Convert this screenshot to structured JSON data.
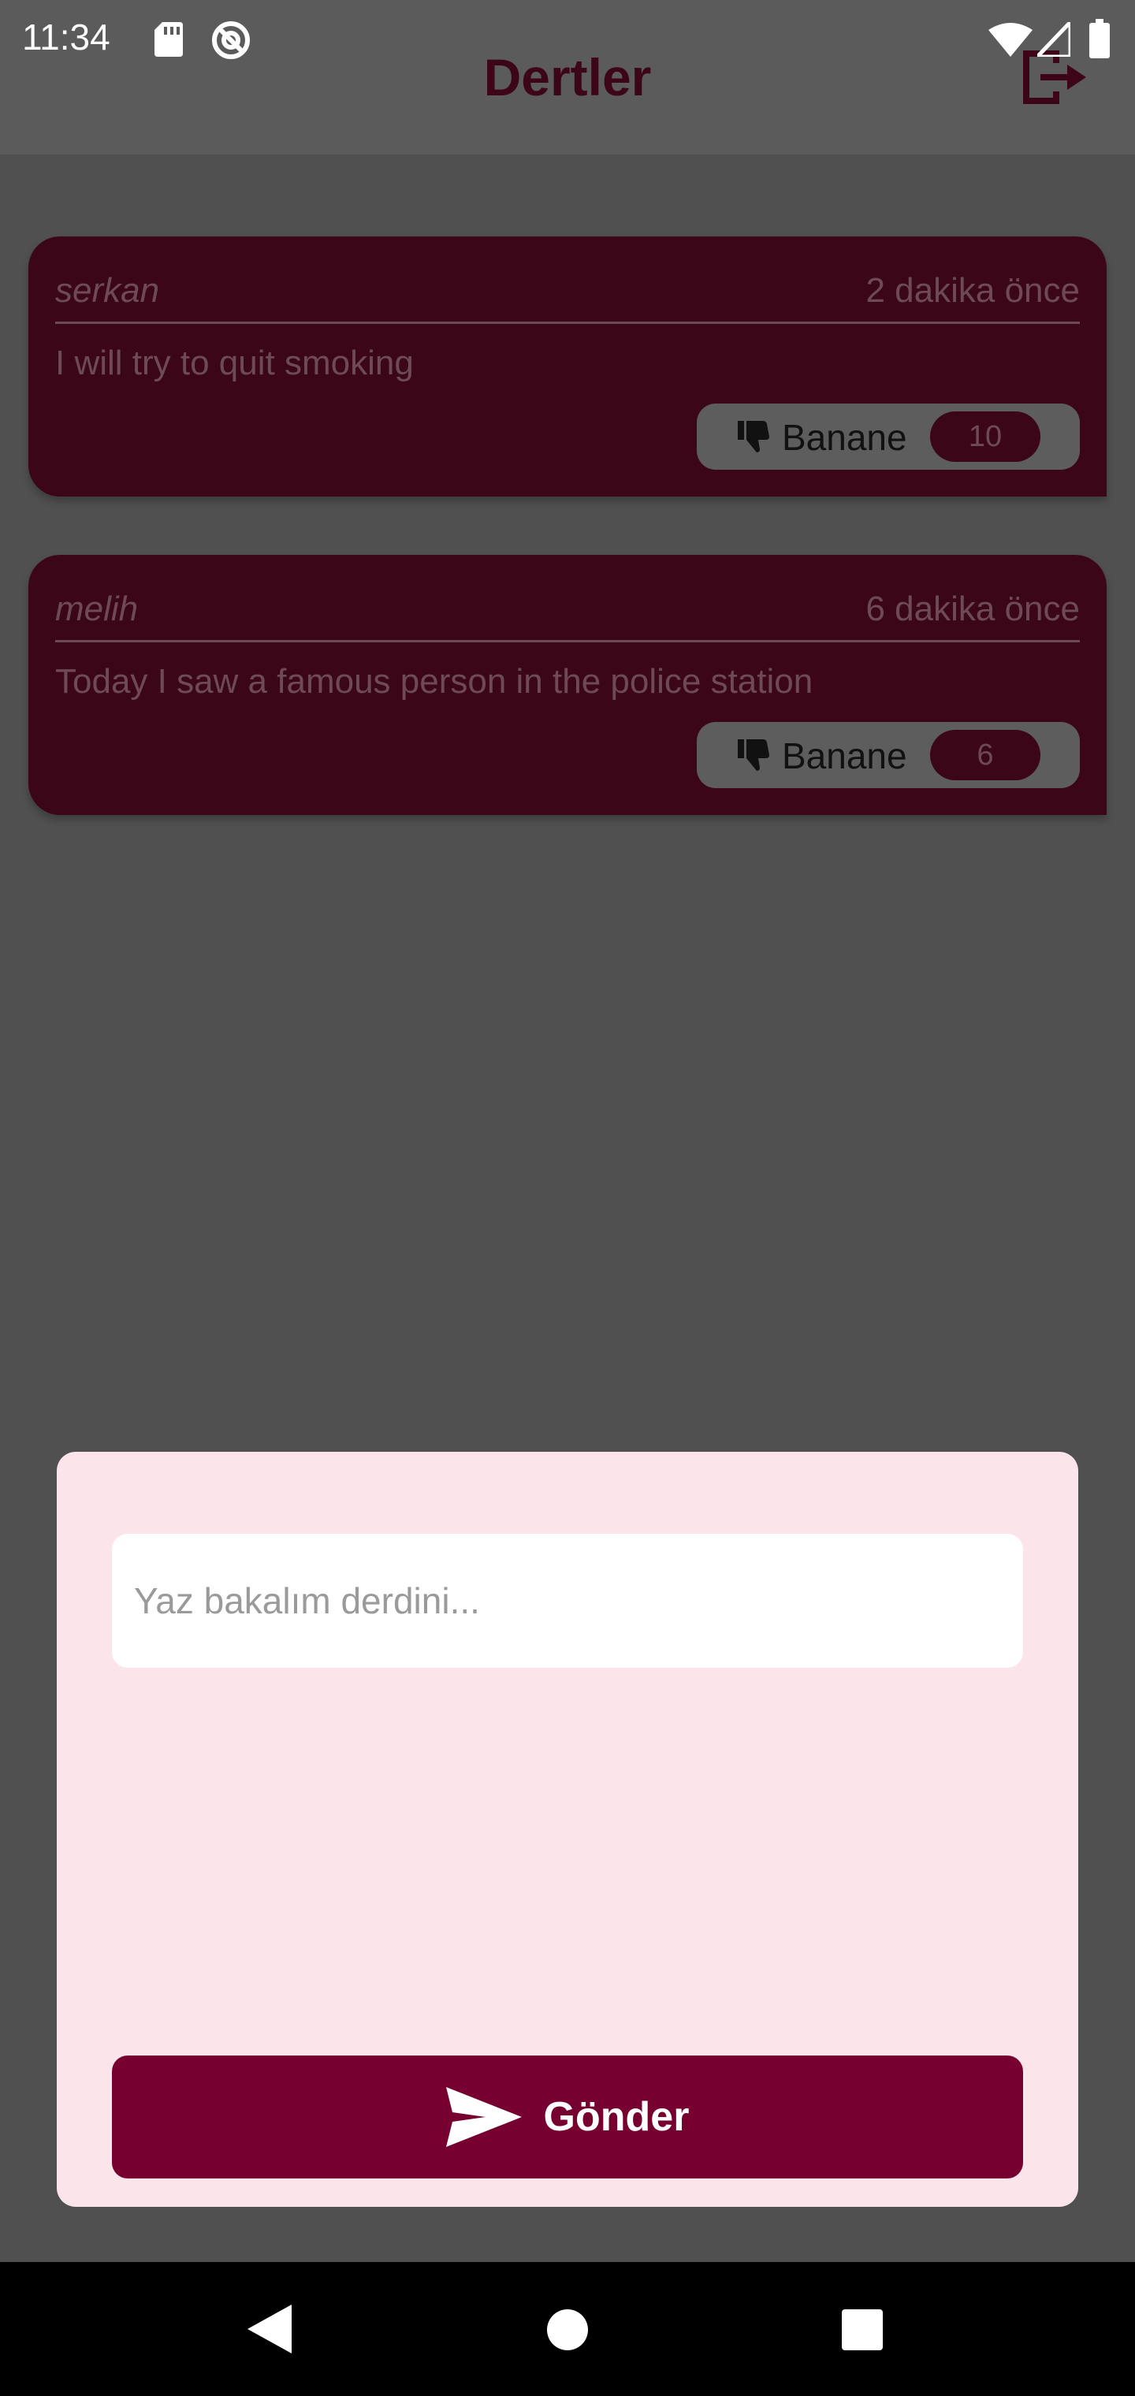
{
  "status_bar": {
    "time": "11:34",
    "icons": [
      "sd-card-icon",
      "vpn-icon",
      "wifi-icon",
      "signal-icon",
      "battery-icon"
    ]
  },
  "app_bar": {
    "title": "Dertler",
    "action_icon": "logout-icon"
  },
  "posts": [
    {
      "author": "serkan",
      "time_ago": "2 dakika önce",
      "text": "I will try to quit smoking",
      "reaction_label": "Banane",
      "reaction_count": "10"
    },
    {
      "author": "melih",
      "time_ago": "6 dakika önce",
      "text": "Today I saw a famous person in the police station",
      "reaction_label": "Banane",
      "reaction_count": "6"
    }
  ],
  "dialog": {
    "input_placeholder": "Yaz bakalım derdini...",
    "input_value": "",
    "send_label": "Gönder",
    "send_icon": "send-icon"
  },
  "colors": {
    "accent": "#760030",
    "dialog_bg": "#fbe4ea",
    "card_bg": "#3a0618",
    "scrim": "#505050"
  }
}
